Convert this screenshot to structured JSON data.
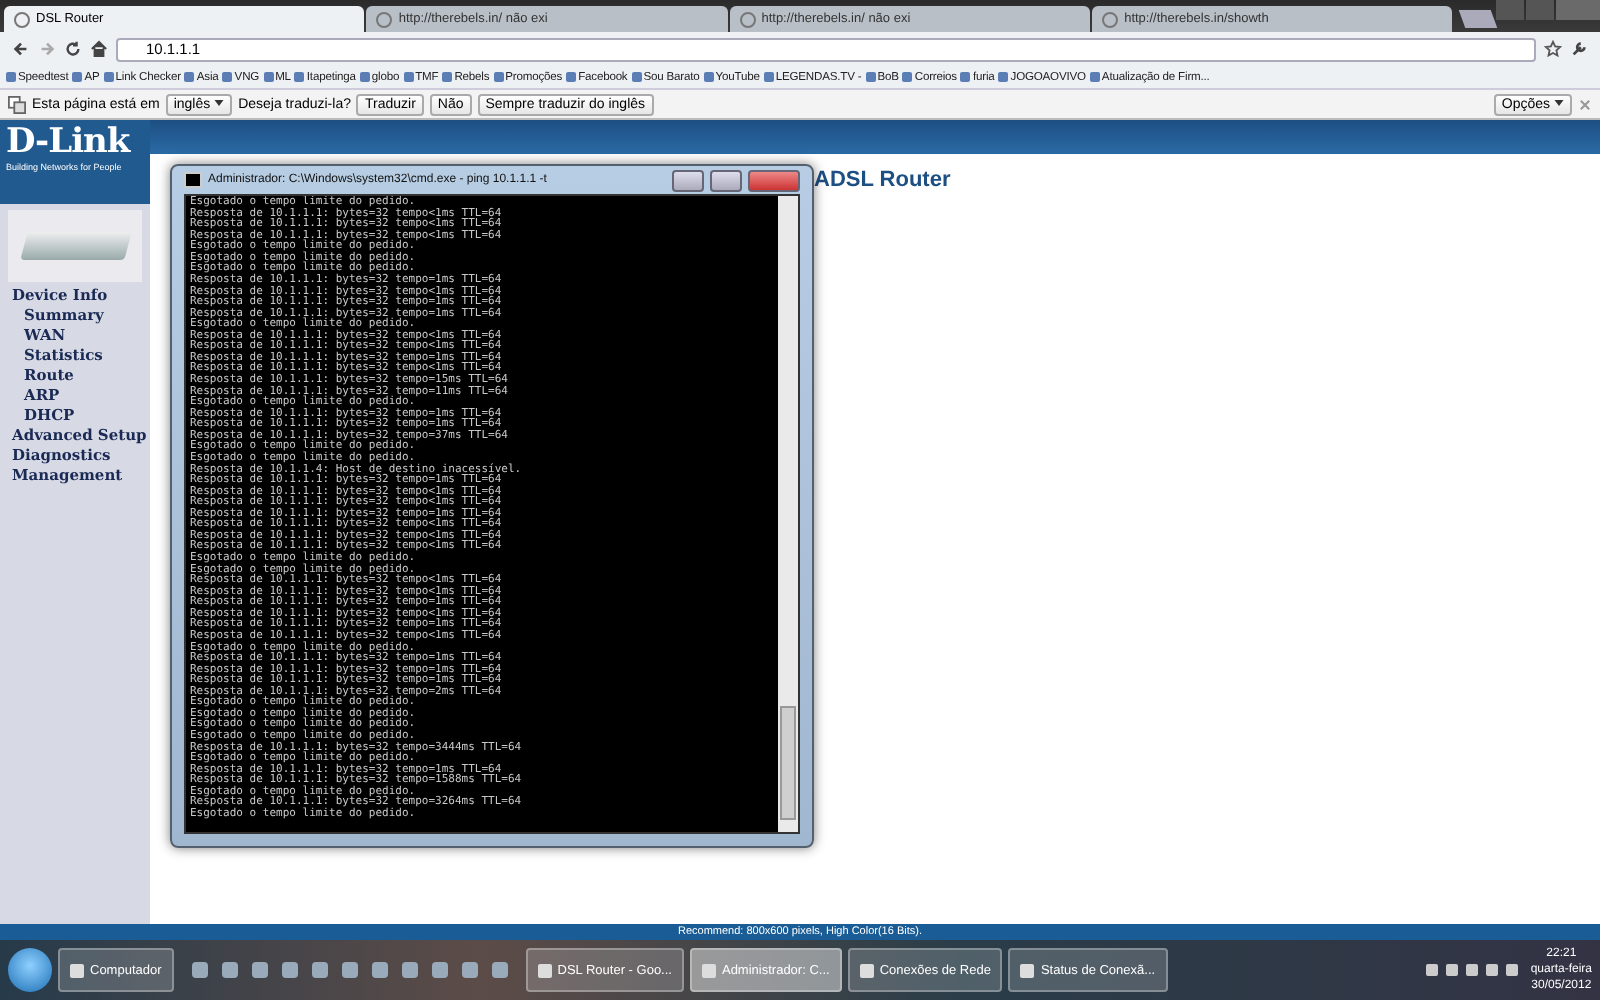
{
  "browser": {
    "tabs": [
      {
        "title": "DSL Router",
        "selected": true
      },
      {
        "title": "http://therebels.in/ não exi",
        "selected": false
      },
      {
        "title": "http://therebels.in/ não exi",
        "selected": false
      },
      {
        "title": "http://therebels.in/showth",
        "selected": false
      }
    ],
    "address": "10.1.1.1",
    "bookmarks": [
      "Speedtest",
      "AP",
      "Link Checker",
      "Asia",
      "VNG",
      "ML",
      "Itapetinga",
      "globo",
      "TMF",
      "Rebels",
      "Promoções",
      "Facebook",
      "Sou Barato",
      "YouTube",
      "LEGENDAS.TV -",
      "BoB",
      "Correios",
      "furia",
      "JOGOAOVIVO",
      "Atualização de Firm..."
    ],
    "translate_bar": {
      "lead": "Esta página está em",
      "language": "inglês",
      "question": "Deseja traduzi-la?",
      "buttons": [
        "Traduzir",
        "Não",
        "Sempre traduzir do inglês"
      ],
      "options": "Opções"
    }
  },
  "page": {
    "logo": "D-Link",
    "tagline": "Building Networks for People",
    "title": "ADSL Router",
    "menu": [
      {
        "label": "Device Info",
        "children": [
          {
            "label": "Summary"
          },
          {
            "label": "WAN"
          },
          {
            "label": "Statistics"
          },
          {
            "label": "Route"
          },
          {
            "label": "ARP"
          },
          {
            "label": "DHCP"
          }
        ]
      },
      {
        "label": "Advanced Setup"
      },
      {
        "label": "Diagnostics"
      },
      {
        "label": "Management"
      }
    ],
    "footer": "Recommend: 800x600 pixels, High Color(16 Bits)."
  },
  "console": {
    "title": "Administrador: C:\\Windows\\system32\\cmd.exe - ping  10.1.1.1 -t",
    "lines": [
      "Esgotado o tempo limite do pedido.",
      "Resposta de 10.1.1.1: bytes=32 tempo<1ms TTL=64",
      "Resposta de 10.1.1.1: bytes=32 tempo<1ms TTL=64",
      "Resposta de 10.1.1.1: bytes=32 tempo<1ms TTL=64",
      "Esgotado o tempo limite do pedido.",
      "Esgotado o tempo limite do pedido.",
      "Esgotado o tempo limite do pedido.",
      "Resposta de 10.1.1.1: bytes=32 tempo=1ms TTL=64",
      "Resposta de 10.1.1.1: bytes=32 tempo<1ms TTL=64",
      "Resposta de 10.1.1.1: bytes=32 tempo=1ms TTL=64",
      "Resposta de 10.1.1.1: bytes=32 tempo=1ms TTL=64",
      "Esgotado o tempo limite do pedido.",
      "Resposta de 10.1.1.1: bytes=32 tempo<1ms TTL=64",
      "Resposta de 10.1.1.1: bytes=32 tempo<1ms TTL=64",
      "Resposta de 10.1.1.1: bytes=32 tempo=1ms TTL=64",
      "Resposta de 10.1.1.1: bytes=32 tempo<1ms TTL=64",
      "Resposta de 10.1.1.1: bytes=32 tempo=15ms TTL=64",
      "Resposta de 10.1.1.1: bytes=32 tempo=11ms TTL=64",
      "Esgotado o tempo limite do pedido.",
      "Resposta de 10.1.1.1: bytes=32 tempo=1ms TTL=64",
      "Resposta de 10.1.1.1: bytes=32 tempo=1ms TTL=64",
      "Resposta de 10.1.1.1: bytes=32 tempo=37ms TTL=64",
      "Esgotado o tempo limite do pedido.",
      "Esgotado o tempo limite do pedido.",
      "Resposta de 10.1.1.4: Host de destino inacessível.",
      "Resposta de 10.1.1.1: bytes=32 tempo=1ms TTL=64",
      "Resposta de 10.1.1.1: bytes=32 tempo<1ms TTL=64",
      "Resposta de 10.1.1.1: bytes=32 tempo<1ms TTL=64",
      "Resposta de 10.1.1.1: bytes=32 tempo=1ms TTL=64",
      "Resposta de 10.1.1.1: bytes=32 tempo<1ms TTL=64",
      "Resposta de 10.1.1.1: bytes=32 tempo<1ms TTL=64",
      "Resposta de 10.1.1.1: bytes=32 tempo<1ms TTL=64",
      "Esgotado o tempo limite do pedido.",
      "Esgotado o tempo limite do pedido.",
      "Resposta de 10.1.1.1: bytes=32 tempo<1ms TTL=64",
      "Resposta de 10.1.1.1: bytes=32 tempo<1ms TTL=64",
      "Resposta de 10.1.1.1: bytes=32 tempo=1ms TTL=64",
      "Resposta de 10.1.1.1: bytes=32 tempo<1ms TTL=64",
      "Resposta de 10.1.1.1: bytes=32 tempo=1ms TTL=64",
      "Resposta de 10.1.1.1: bytes=32 tempo<1ms TTL=64",
      "Esgotado o tempo limite do pedido.",
      "Resposta de 10.1.1.1: bytes=32 tempo=1ms TTL=64",
      "Resposta de 10.1.1.1: bytes=32 tempo=1ms TTL=64",
      "Resposta de 10.1.1.1: bytes=32 tempo=1ms TTL=64",
      "Resposta de 10.1.1.1: bytes=32 tempo=2ms TTL=64",
      "Esgotado o tempo limite do pedido.",
      "Esgotado o tempo limite do pedido.",
      "Esgotado o tempo limite do pedido.",
      "Esgotado o tempo limite do pedido.",
      "Resposta de 10.1.1.1: bytes=32 tempo=3444ms TTL=64",
      "Esgotado o tempo limite do pedido.",
      "Resposta de 10.1.1.1: bytes=32 tempo=1ms TTL=64",
      "Resposta de 10.1.1.1: bytes=32 tempo=1588ms TTL=64",
      "Esgotado o tempo limite do pedido.",
      "Resposta de 10.1.1.1: bytes=32 tempo=3264ms TTL=64",
      "Esgotado o tempo limite do pedido."
    ]
  },
  "taskbar": {
    "items": [
      {
        "label": "Computador",
        "selected": false
      },
      {
        "label": "DSL Router - Goo...",
        "selected": false
      },
      {
        "label": "Administrador: C...",
        "selected": true
      },
      {
        "label": "Conexões de Rede",
        "selected": false
      },
      {
        "label": "Status de Conexã...",
        "selected": false
      }
    ],
    "time": "22:21",
    "weekday": "quarta-feira",
    "date": "30/05/2012"
  }
}
